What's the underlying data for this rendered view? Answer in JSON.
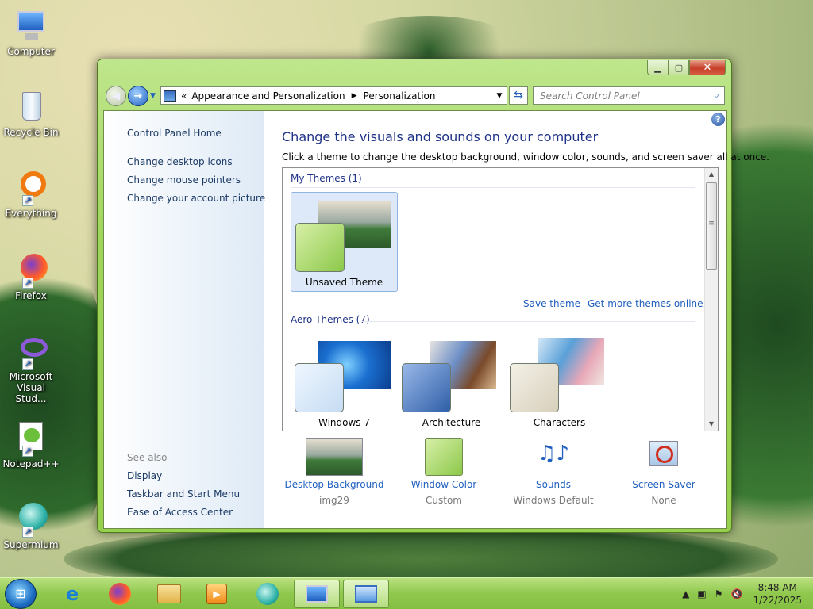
{
  "desktop": {
    "icons": [
      {
        "label": "Computer"
      },
      {
        "label": "Recycle Bin"
      },
      {
        "label": "Everything"
      },
      {
        "label": "Firefox"
      },
      {
        "label": "Microsoft Visual Stud..."
      },
      {
        "label": "Notepad++"
      },
      {
        "label": "Supermium"
      }
    ]
  },
  "window": {
    "address": {
      "chevron": "«",
      "crumbs": [
        "Appearance and Personalization",
        "Personalization"
      ]
    },
    "search_placeholder": "Search Control Panel",
    "sidebar": {
      "home": "Control Panel Home",
      "links": [
        "Change desktop icons",
        "Change mouse pointers",
        "Change your account picture"
      ],
      "see_also_label": "See also",
      "see_also": [
        "Display",
        "Taskbar and Start Menu",
        "Ease of Access Center"
      ]
    },
    "heading": "Change the visuals and sounds on your computer",
    "subtitle": "Click a theme to change the desktop background, window color, sounds, and screen saver all at once.",
    "my_themes": {
      "label": "My Themes (1)",
      "items": [
        {
          "name": "Unsaved Theme",
          "selected": true
        }
      ]
    },
    "links": {
      "save_theme": "Save theme",
      "get_more": "Get more themes online"
    },
    "aero_themes": {
      "label": "Aero Themes (7)",
      "items": [
        {
          "name": "Windows 7"
        },
        {
          "name": "Architecture"
        },
        {
          "name": "Characters"
        }
      ]
    },
    "bottom": [
      {
        "label": "Desktop Background",
        "value": "img29",
        "icon": "landscape-thumbnail"
      },
      {
        "label": "Window Color",
        "value": "Custom",
        "icon": "green-color-swatch"
      },
      {
        "label": "Sounds",
        "value": "Windows Default",
        "icon": "music-notes-icon"
      },
      {
        "label": "Screen Saver",
        "value": "None",
        "icon": "screen-saver-icon"
      }
    ]
  },
  "taskbar": {
    "clock": {
      "time": "8:48 AM",
      "date": "1/22/2025"
    }
  },
  "colors": {
    "window_frame": "#9ed45a",
    "heading": "#1e3287",
    "link": "#1f5fbf",
    "taskbar": "#90c84e"
  }
}
